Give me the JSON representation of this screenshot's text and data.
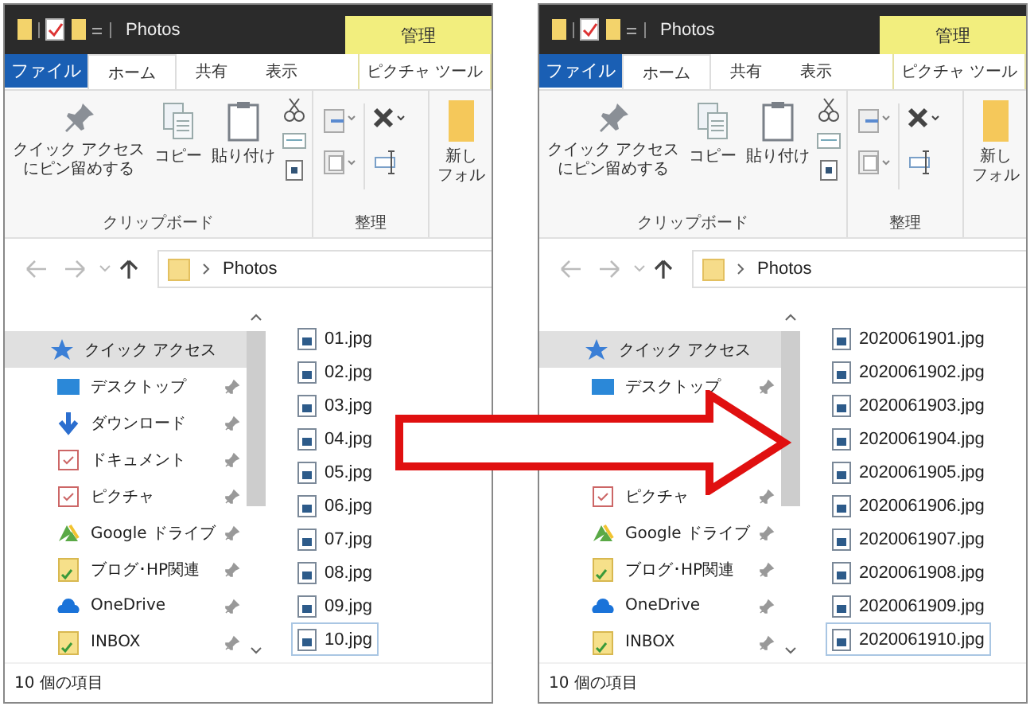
{
  "windows": [
    {
      "title": "Photos",
      "context_tab": "管理",
      "tabs": [
        {
          "label": "ファイル",
          "kind": "file",
          "selected": false
        },
        {
          "label": "ホーム",
          "kind": "plain",
          "selected": true
        },
        {
          "label": "共有",
          "kind": "plain",
          "selected": false
        },
        {
          "label": "表示",
          "kind": "plain",
          "selected": false
        },
        {
          "label": "ピクチャ ツール",
          "kind": "context",
          "selected": false
        }
      ],
      "ribbon_groups": [
        {
          "label": "クリップボード",
          "items": [
            {
              "kind": "pin",
              "lines": [
                "クイック アクセス",
                "にピン留めする"
              ]
            },
            {
              "kind": "copy",
              "label": "コピー"
            },
            {
              "kind": "paste",
              "label": "貼り付け"
            },
            {
              "kind": "small-stack"
            }
          ]
        },
        {
          "label": "整理",
          "items": [
            {
              "kind": "organize"
            }
          ]
        },
        {
          "items": [
            {
              "kind": "new-folder",
              "lines": [
                "新し",
                "フォル"
              ]
            }
          ]
        }
      ],
      "address": {
        "path": "Photos"
      },
      "nav_items": [
        {
          "kind": "star",
          "label": "クイック アクセス",
          "selected": true,
          "pinned": false,
          "covered": false
        },
        {
          "kind": "desktop",
          "label": "デスクトップ",
          "selected": false,
          "pinned": true,
          "covered": false
        },
        {
          "kind": "download",
          "label": "ダウンロード",
          "selected": false,
          "pinned": true,
          "covered": false
        },
        {
          "kind": "document",
          "label": "ドキュメント",
          "selected": false,
          "pinned": true,
          "covered": false
        },
        {
          "kind": "picture",
          "label": "ピクチャ",
          "selected": false,
          "pinned": true,
          "covered": false
        },
        {
          "kind": "drive",
          "label": "Google ドライブ",
          "selected": false,
          "pinned": true,
          "covered": false
        },
        {
          "kind": "folder",
          "label": "ブログ･HP関連",
          "selected": false,
          "pinned": true,
          "covered": false
        },
        {
          "kind": "cloud",
          "label": "OneDrive",
          "selected": false,
          "pinned": true,
          "covered": false
        },
        {
          "kind": "folder",
          "label": "INBOX",
          "selected": false,
          "pinned": true,
          "covered": false
        }
      ],
      "files": [
        {
          "name": "01.jpg",
          "selected": false
        },
        {
          "name": "02.jpg",
          "selected": false
        },
        {
          "name": "03.jpg",
          "selected": false
        },
        {
          "name": "04.jpg",
          "selected": false
        },
        {
          "name": "05.jpg",
          "selected": false
        },
        {
          "name": "06.jpg",
          "selected": false
        },
        {
          "name": "07.jpg",
          "selected": false
        },
        {
          "name": "08.jpg",
          "selected": false
        },
        {
          "name": "09.jpg",
          "selected": false
        },
        {
          "name": "10.jpg",
          "selected": true
        }
      ],
      "status": "10 個の項目"
    },
    {
      "title": "Photos",
      "context_tab": "管理",
      "tabs": [
        {
          "label": "ファイル",
          "kind": "file",
          "selected": false
        },
        {
          "label": "ホーム",
          "kind": "plain",
          "selected": true
        },
        {
          "label": "共有",
          "kind": "plain",
          "selected": false
        },
        {
          "label": "表示",
          "kind": "plain",
          "selected": false
        },
        {
          "label": "ピクチャ ツール",
          "kind": "context",
          "selected": false
        }
      ],
      "ribbon_groups": [
        {
          "label": "クリップボード",
          "items": [
            {
              "kind": "pin",
              "lines": [
                "クイック アクセス",
                "にピン留めする"
              ]
            },
            {
              "kind": "copy",
              "label": "コピー"
            },
            {
              "kind": "paste",
              "label": "貼り付け"
            },
            {
              "kind": "small-stack"
            }
          ]
        },
        {
          "label": "整理",
          "items": [
            {
              "kind": "organize"
            }
          ]
        },
        {
          "items": [
            {
              "kind": "new-folder",
              "lines": [
                "新し",
                "フォル"
              ]
            }
          ]
        }
      ],
      "address": {
        "path": "Photos"
      },
      "nav_items": [
        {
          "kind": "star",
          "label": "クイック アクセス",
          "selected": true,
          "pinned": false,
          "covered": false
        },
        {
          "kind": "desktop",
          "label": "デスクトップ",
          "selected": false,
          "pinned": true,
          "covered": false
        },
        {
          "covered": true
        },
        {
          "covered": true
        },
        {
          "kind": "picture",
          "label": "ピクチャ",
          "selected": false,
          "pinned": true,
          "covered": false
        },
        {
          "kind": "drive",
          "label": "Google ドライブ",
          "selected": false,
          "pinned": true,
          "covered": false
        },
        {
          "kind": "folder",
          "label": "ブログ･HP関連",
          "selected": false,
          "pinned": true,
          "covered": false
        },
        {
          "kind": "cloud",
          "label": "OneDrive",
          "selected": false,
          "pinned": true,
          "covered": false
        },
        {
          "kind": "folder",
          "label": "INBOX",
          "selected": false,
          "pinned": true,
          "covered": false
        }
      ],
      "files": [
        {
          "name": "2020061901.jpg",
          "selected": false
        },
        {
          "name": "2020061902.jpg",
          "selected": false
        },
        {
          "name": "2020061903.jpg",
          "selected": false
        },
        {
          "name": "2020061904.jpg",
          "selected": false
        },
        {
          "name": "2020061905.jpg",
          "selected": false
        },
        {
          "name": "2020061906.jpg",
          "selected": false
        },
        {
          "name": "2020061907.jpg",
          "selected": false
        },
        {
          "name": "2020061908.jpg",
          "selected": false
        },
        {
          "name": "2020061909.jpg",
          "selected": false
        },
        {
          "name": "2020061910.jpg",
          "selected": true
        }
      ],
      "status": "10 個の項目"
    }
  ]
}
